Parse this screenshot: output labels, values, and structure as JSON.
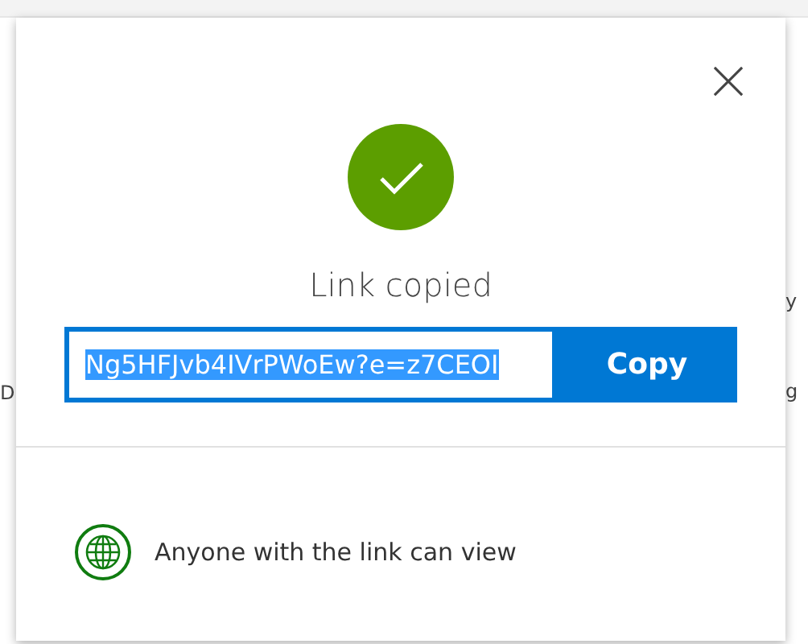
{
  "background": {
    "left_fragments": [
      "D"
    ],
    "right_fragments": [
      "y",
      "g"
    ]
  },
  "dialog": {
    "title": "Link copied",
    "link": {
      "value": "Ng5HFJvb4IVrPWoEw?e=z7CEOI",
      "selected": true
    },
    "copy_button": "Copy",
    "permission": "Anyone with the link can view"
  }
}
